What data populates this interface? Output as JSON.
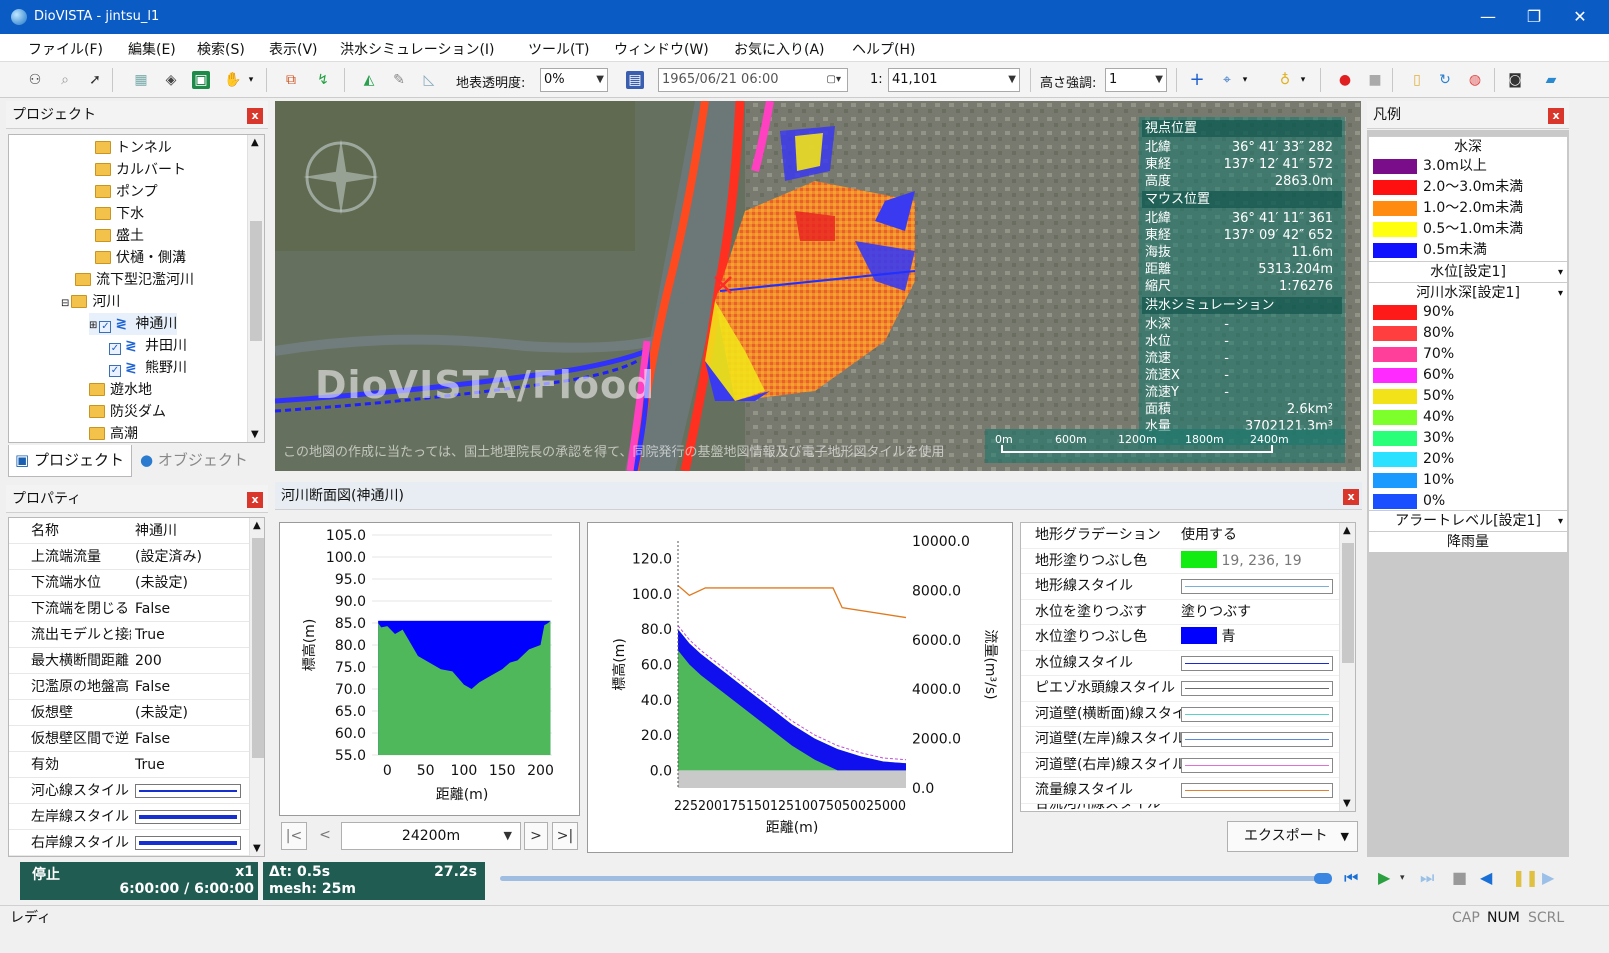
{
  "window": {
    "title": "DioVISTA - jintsu_l1",
    "min": "—",
    "restore": "❐",
    "close": "✕"
  },
  "menu": [
    "ファイル(F)",
    "編集(E)",
    "検索(S)",
    "表示(V)",
    "洪水シミュレーション(I)",
    "ツール(T)",
    "ウィンドウ(W)",
    "お気に入り(A)",
    "ヘルプ(H)"
  ],
  "toolbar": {
    "opacity_label": "地表透明度:",
    "opacity_value": "0%",
    "datetime": "1965/06/21 06:00",
    "scale_prefix": "1:",
    "scale_value": "41,101",
    "height_label": "高さ強調:",
    "height_value": "1"
  },
  "project": {
    "title": "プロジェクト",
    "tree": [
      "トンネル",
      "カルバート",
      "ポンプ",
      "下水",
      "盛土",
      "伏樋・側溝",
      "流下型氾濫河川",
      "河川",
      "神通川",
      "井田川",
      "熊野川",
      "遊水地",
      "防災ダム",
      "高潮"
    ],
    "tabs": [
      "プロジェクト",
      "オブジェクト"
    ]
  },
  "properties": {
    "title": "プロパティ",
    "rows": [
      {
        "name": "名称",
        "value": "神通川"
      },
      {
        "name": "上流端流量",
        "value": "(設定済み)"
      },
      {
        "name": "下流端水位",
        "value": "(未設定)"
      },
      {
        "name": "下流端を閉じる",
        "value": "False"
      },
      {
        "name": "流出モデルと接続",
        "value": "True"
      },
      {
        "name": "最大横断間距離",
        "value": "200"
      },
      {
        "name": "氾濫原の地盤高",
        "value": "False"
      },
      {
        "name": "仮想壁",
        "value": "(未設定)"
      },
      {
        "name": "仮想壁区間で逆",
        "value": "False"
      },
      {
        "name": "有効",
        "value": "True"
      },
      {
        "name": "河心線スタイル",
        "value": ""
      },
      {
        "name": "左岸線スタイル",
        "value": ""
      },
      {
        "name": "右岸線スタイル",
        "value": ""
      }
    ]
  },
  "map": {
    "watermark": "DioVISTA/Flood",
    "credit": "この地図の作成に当たっては、国土地理院長の承認を得て、同院発行の基盤地図情報及び電子地形図タイルを使用",
    "info": {
      "viewpoint": "視点位置",
      "vp_rows": [
        [
          "北緯",
          "36° 41′ 33″ 282"
        ],
        [
          "東経",
          "137° 12′ 41″ 572"
        ],
        [
          "高度",
          "2863.0m"
        ]
      ],
      "mouse": "マウス位置",
      "mouse_rows": [
        [
          "北緯",
          "36° 41′ 11″ 361"
        ],
        [
          "東経",
          "137° 09′ 42″ 652"
        ],
        [
          "海抜",
          "11.6m"
        ],
        [
          "距離",
          "5313.204m"
        ],
        [
          "縮尺",
          "1:76276"
        ]
      ],
      "sim": "洪水シミュレーション",
      "sim_rows": [
        [
          "水深",
          "-"
        ],
        [
          "水位",
          "-"
        ],
        [
          "流速",
          "-"
        ],
        [
          "流速X",
          "-"
        ],
        [
          "流速Y",
          "-"
        ],
        [
          "面積",
          "2.6km²"
        ],
        [
          "水量",
          "3702121.3m³"
        ]
      ]
    },
    "scale_ticks": [
      "0m",
      "600m",
      "1200m",
      "1800m",
      "2400m"
    ]
  },
  "legend": {
    "title": "凡例",
    "depth_title": "水深",
    "depth": [
      {
        "label": "3.0m以上",
        "color": "#7a0d8a"
      },
      {
        "label": "2.0～3.0m未満",
        "color": "#ff1010"
      },
      {
        "label": "1.0～2.0m未満",
        "color": "#ff8c10"
      },
      {
        "label": "0.5～1.0m未満",
        "color": "#ffff10"
      },
      {
        "label": "0.5m未満",
        "color": "#1010ff"
      }
    ],
    "wl_title": "水位[設定1]",
    "rd_title": "河川水深[設定1]",
    "river_depth": [
      {
        "label": "90%",
        "color": "#ff1a1a"
      },
      {
        "label": "80%",
        "color": "#ff3f3f"
      },
      {
        "label": "70%",
        "color": "#ff3f9a"
      },
      {
        "label": "60%",
        "color": "#ff2aff"
      },
      {
        "label": "50%",
        "color": "#f2e21a"
      },
      {
        "label": "40%",
        "color": "#7cff2a"
      },
      {
        "label": "30%",
        "color": "#2aff7a"
      },
      {
        "label": "20%",
        "color": "#2ae2ff"
      },
      {
        "label": "10%",
        "color": "#1a9aff"
      },
      {
        "label": "0%",
        "color": "#1a4fff"
      }
    ],
    "alert_title": "アラートレベル[設定1]",
    "rain_title": "降雨量"
  },
  "cross_section": {
    "title": "河川断面図(神通川)",
    "nav_value": "24200m",
    "export": "エクスポート"
  },
  "chart_data": [
    {
      "type": "area",
      "ylabel": "標高(m)",
      "xlabel": "距離(m)",
      "ylim": [
        55,
        105
      ],
      "xlim": [
        -20,
        215
      ],
      "y_ticks": [
        "105.0",
        "100.0",
        "95.0",
        "90.0",
        "85.0",
        "80.0",
        "75.0",
        "70.0",
        "65.0",
        "60.0",
        "55.0"
      ],
      "x_ticks": [
        "0",
        "50",
        "100",
        "150",
        "200"
      ],
      "water_level": 85.5,
      "ground_x": [
        -12,
        -8,
        0,
        10,
        20,
        30,
        40,
        55,
        70,
        85,
        100,
        110,
        120,
        135,
        150,
        160,
        170,
        185,
        200,
        205,
        210,
        213
      ],
      "ground_y": [
        85.0,
        84.0,
        84.3,
        82.5,
        83.5,
        80.5,
        77.5,
        76.0,
        74.5,
        74.0,
        71.0,
        70.0,
        71.5,
        73.0,
        74.5,
        76.0,
        76.5,
        79.0,
        80.0,
        84.5,
        85.0,
        85.5
      ]
    },
    {
      "type": "area",
      "ylabel": "標高(m)",
      "y2label": "流量(m³/s)",
      "xlabel": "距離(m)",
      "ylim": [
        -10,
        130
      ],
      "y2lim": [
        0,
        10000
      ],
      "y_ticks": [
        "120.0",
        "100.0",
        "80.0",
        "60.0",
        "40.0",
        "20.0",
        "0.0"
      ],
      "y2_ticks": [
        "10000.0",
        "8000.0",
        "6000.0",
        "4000.0",
        "2000.0",
        "0.0"
      ],
      "x_ticks_text": "22520017515012510075050025000",
      "profile_x": [
        0,
        0.05,
        0.1,
        0.2,
        0.3,
        0.4,
        0.5,
        0.6,
        0.7,
        0.8,
        0.9,
        1.0
      ],
      "profile_y": [
        80,
        72,
        66,
        56,
        46,
        36,
        26,
        18,
        12,
        8,
        5,
        4
      ],
      "discharge_x": [
        0,
        0.05,
        0.12,
        0.2,
        0.4,
        0.6,
        0.68,
        0.72,
        1.0
      ],
      "discharge_y": [
        8200,
        7800,
        8100,
        8100,
        8100,
        8100,
        8100,
        7300,
        6900
      ]
    }
  ],
  "line_props": [
    {
      "name": "地形グラデーション",
      "value": "使用する"
    },
    {
      "name": "地形塗りつぶし色",
      "value": "19, 236, 19",
      "swatch": "#13ec13"
    },
    {
      "name": "地形線スタイル",
      "line": "#7ab0d8"
    },
    {
      "name": "水位を塗りつぶす",
      "value": "塗りつぶす"
    },
    {
      "name": "水位塗りつぶし色",
      "value": "青",
      "swatch": "#0000ff"
    },
    {
      "name": "水位線スタイル",
      "line": "#1a2ad0"
    },
    {
      "name": "ピエゾ水頭線スタイル",
      "line": "#6a6a6a"
    },
    {
      "name": "河道壁(横断面)線スタイル",
      "line": "#5ad0c8"
    },
    {
      "name": "河道壁(左岸)線スタイル",
      "line": "#5a8ad8"
    },
    {
      "name": "河道壁(右岸)線スタイル",
      "line": "#e070d8"
    },
    {
      "name": "流量線スタイル",
      "line": "#e08030"
    },
    {
      "name": "合流河川線スタイル",
      "line": "#333333"
    }
  ],
  "playback": {
    "state": "停止",
    "speed": "x1",
    "time": "6:00:00 / 6:00:00",
    "dt": "Δt: 0.5s",
    "elapsed": "27.2s",
    "mesh": "mesh: 25m"
  },
  "statusbar": {
    "ready": "レディ",
    "cap": "CAP",
    "num": "NUM",
    "scrl": "SCRL"
  }
}
